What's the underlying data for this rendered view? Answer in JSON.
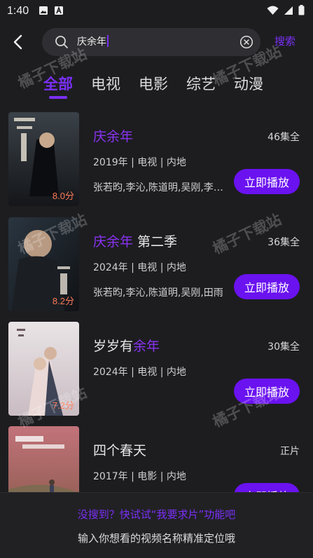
{
  "status_bar": {
    "time": "1:40"
  },
  "search": {
    "query": "庆余年",
    "submit_label": "搜索"
  },
  "tabs": [
    {
      "label": "全部",
      "active": true
    },
    {
      "label": "电视",
      "active": false
    },
    {
      "label": "电影",
      "active": false
    },
    {
      "label": "综艺",
      "active": false
    },
    {
      "label": "动漫",
      "active": false
    }
  ],
  "results": [
    {
      "title_highlight": "庆余年",
      "title_suffix": "",
      "episodes": "46集全",
      "meta": "2019年 | 电视 | 内地",
      "cast": "张若昀,李沁,陈道明,吴刚,李纯,辛芷蕾",
      "score": "8.0分",
      "play_label": "立即播放"
    },
    {
      "title_highlight": "庆余年",
      "title_suffix": " 第二季",
      "episodes": "36集全",
      "meta": "2024年 | 电视 | 内地",
      "cast": "张若昀,李沁,陈道明,吴刚,田雨",
      "score": "8.2分",
      "play_label": "立即播放"
    },
    {
      "title_prefix": "岁岁有",
      "title_highlight": "余年",
      "episodes": "30集全",
      "meta": "2024年 | 电视 | 内地",
      "cast": "",
      "score": "7.2分",
      "play_label": "立即播放"
    },
    {
      "title_plain": "四个春天",
      "episodes": "正片",
      "meta": "2017年 | 电影 | 内地",
      "cast": "",
      "score": "",
      "play_label": "立即播放"
    }
  ],
  "bottom": {
    "request_link": "没搜到？快试试“我要求片”功能吧",
    "hint": "输入你想看的视频名称精准定位哦"
  },
  "watermark": "橘子下载站",
  "colors": {
    "accent": "#7b2ff7",
    "button": "#6a12f0",
    "score": "#ff7a59",
    "background": "#1d1d20"
  }
}
